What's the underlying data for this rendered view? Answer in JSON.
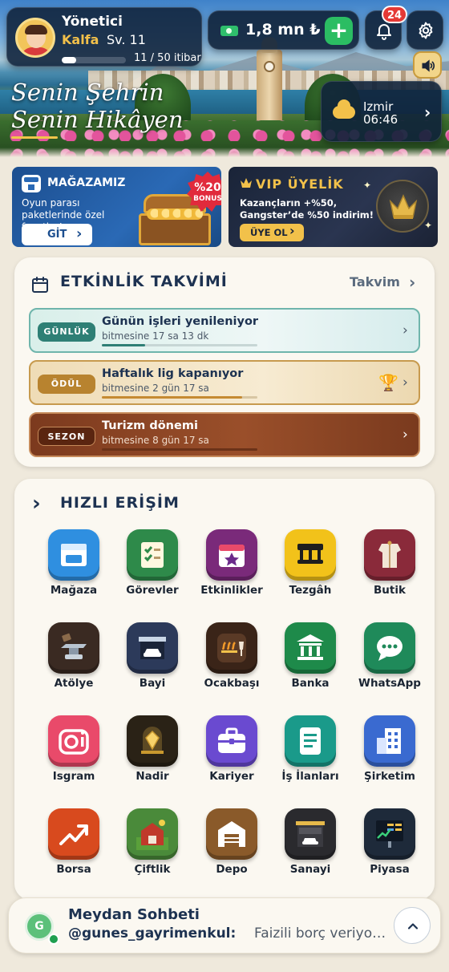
{
  "hero": {
    "title_line1": "Senin Şehrin",
    "title_line2": "Senin Hikâyen"
  },
  "profile": {
    "name": "Yönetici",
    "rank": "Kalfa",
    "level": "Sv. 11",
    "reputation": "11 / 50 itibar",
    "reputation_progress": 0.22
  },
  "wallet": {
    "amount": "1,8 mn ₺",
    "add_label": "+"
  },
  "notifications": {
    "count": "24"
  },
  "weather": {
    "city": "Izmir",
    "time": "06:46"
  },
  "promos": {
    "store": {
      "title": "MAĞAZAMIZ",
      "description": "Oyun parası paketlerinde özel fırsatlar!",
      "button": "GİT",
      "bonus_percent": "%20",
      "bonus_label": "BONUS"
    },
    "vip": {
      "title": "VIP ÜYELİK",
      "description": "Kazançların +%50, Gangster’de %50 indirim!",
      "button": "ÜYE OL"
    }
  },
  "calendar": {
    "title": "ETKİNLİK TAKVİMİ",
    "link": "Takvim",
    "events": [
      {
        "tag": "GÜNLÜK",
        "title": "Günün işleri yenileniyor",
        "remaining": "bitmesine 17 sa 13 dk",
        "progress": 0.28
      },
      {
        "tag": "ÖDÜL",
        "title": "Haftalık lig kapanıyor",
        "remaining": "bitmesine 2 gün 17 sa",
        "progress": 0.9
      },
      {
        "tag": "SEZON",
        "title": "Turizm dönemi",
        "remaining": "bitmesine 8 gün 17 sa",
        "progress": 0
      }
    ]
  },
  "quick_access": {
    "title": "HIZLI ERİŞİM",
    "items": [
      {
        "label": "Mağaza",
        "icon": "store-icon",
        "color": "#2f8fe0"
      },
      {
        "label": "Görevler",
        "icon": "checklist-icon",
        "color": "#2e8a4a"
      },
      {
        "label": "Etkinlikler",
        "icon": "calendar-star-icon",
        "color": "#7a2a7a"
      },
      {
        "label": "Tezgâh",
        "icon": "stall-icon",
        "color": "#f2c21a"
      },
      {
        "label": "Butik",
        "icon": "garment-icon",
        "color": "#8a2a3a"
      },
      {
        "label": "Atölye",
        "icon": "anvil-icon",
        "color": "#3a2a22"
      },
      {
        "label": "Bayi",
        "icon": "car-dealer-icon",
        "color": "#2c3a5a"
      },
      {
        "label": "Ocakbaşı",
        "icon": "grill-icon",
        "color": "#3a2418"
      },
      {
        "label": "Banka",
        "icon": "bank-icon",
        "color": "#1e8a4a"
      },
      {
        "label": "WhatsApp",
        "icon": "chat-bubble-icon",
        "color": "#1f8a5a"
      },
      {
        "label": "Isgram",
        "icon": "camera-icon",
        "color": "#e94a6a"
      },
      {
        "label": "Nadir",
        "icon": "gem-icon",
        "color": "#2a2216"
      },
      {
        "label": "Kariyer",
        "icon": "briefcase-icon",
        "color": "#6a4ad0"
      },
      {
        "label": "İş İlanları",
        "icon": "document-icon",
        "color": "#1a9a8a"
      },
      {
        "label": "Şirketim",
        "icon": "office-building-icon",
        "color": "#3a6ad0"
      },
      {
        "label": "Borsa",
        "icon": "trend-up-icon",
        "color": "#d84a1e"
      },
      {
        "label": "Çiftlik",
        "icon": "barn-icon",
        "color": "#4a8a3a"
      },
      {
        "label": "Depo",
        "icon": "warehouse-icon",
        "color": "#8a5a2a"
      },
      {
        "label": "Sanayi",
        "icon": "garage-icon",
        "color": "#2a2a2e"
      },
      {
        "label": "Piyasa",
        "icon": "market-board-icon",
        "color": "#1e2a3a"
      }
    ]
  },
  "chat": {
    "room": "Meydan Sohbeti",
    "avatar_letter": "G",
    "user": "@gunes_gayrimenkul:",
    "message": "Faizili borç veriyorum"
  }
}
